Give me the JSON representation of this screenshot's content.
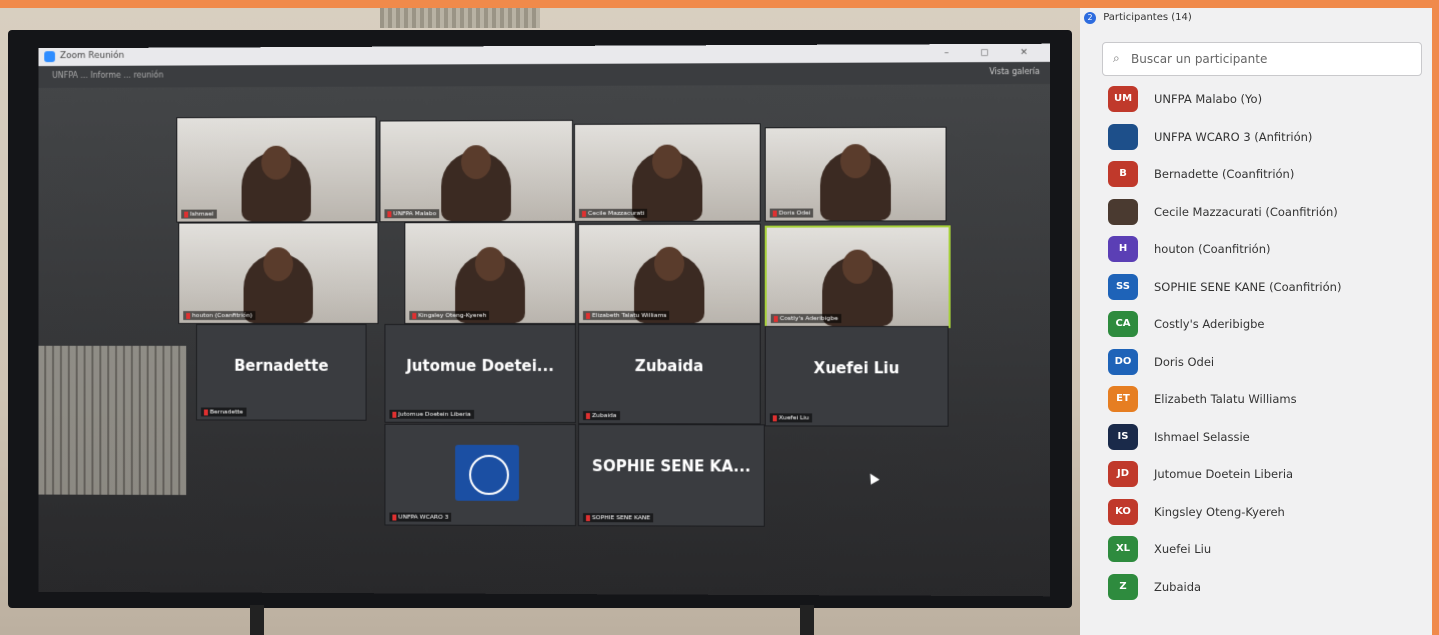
{
  "app": {
    "title": "Zoom Reunión",
    "subtitle": "UNFPA ... Informe ... reunión",
    "view_label": "Vista galería"
  },
  "tiles": [
    {
      "name": "tile-1",
      "type": "video",
      "label": "Ishmael"
    },
    {
      "name": "tile-2",
      "type": "video",
      "label": "UNFPA Malabo"
    },
    {
      "name": "tile-3",
      "type": "video",
      "label": "Cecile Mazzacurati"
    },
    {
      "name": "tile-4",
      "type": "video",
      "label": "Doris Odei"
    },
    {
      "name": "tile-5",
      "type": "video",
      "label": "houton (Coanfitrión)"
    },
    {
      "name": "tile-6",
      "type": "video",
      "label": "Kingsley Oteng-Kyereh"
    },
    {
      "name": "tile-7",
      "type": "video",
      "label": "Elizabeth Talatu Williams"
    },
    {
      "name": "tile-8",
      "type": "video",
      "label": "Costly's Aderibigbe"
    },
    {
      "name": "tile-9",
      "type": "name",
      "big": "Bernadette",
      "label": "Bernadette"
    },
    {
      "name": "tile-10",
      "type": "name",
      "big": "Jutomue Doetei...",
      "label": "Jutomue Doetein Liberia"
    },
    {
      "name": "tile-11",
      "type": "name",
      "big": "Zubaida",
      "label": "Zubaida"
    },
    {
      "name": "tile-12",
      "type": "name",
      "big": "Xuefei Liu",
      "label": "Xuefei Liu"
    },
    {
      "name": "tile-13",
      "type": "logo",
      "label": "UNFPA WCARO 3"
    },
    {
      "name": "tile-14",
      "type": "name",
      "big": "SOPHIE SENE KA...",
      "label": "SOPHIE SENE KANE"
    }
  ],
  "participants_panel": {
    "count_badge": "2",
    "title": "Participantes (14)",
    "search_placeholder": "Buscar un participante",
    "participants": [
      {
        "initials": "UM",
        "name": "UNFPA Malabo (Yo)",
        "color": "#c0392b"
      },
      {
        "initials": "",
        "name": "UNFPA WCARO 3 (Anfitrión)",
        "color": "#1d4f8a"
      },
      {
        "initials": "B",
        "name": "Bernadette (Coanfitrión)",
        "color": "#c0392b"
      },
      {
        "initials": "",
        "name": "Cecile Mazzacurati (Coanfitrión)",
        "color": "#4a3a30"
      },
      {
        "initials": "H",
        "name": "houton (Coanfitrión)",
        "color": "#5b3fb5"
      },
      {
        "initials": "SS",
        "name": "SOPHIE SENE KANE (Coanfitrión)",
        "color": "#1e63b8"
      },
      {
        "initials": "CA",
        "name": "Costly's Aderibigbe",
        "color": "#2e8b3e"
      },
      {
        "initials": "DO",
        "name": "Doris Odei",
        "color": "#1e63b8"
      },
      {
        "initials": "ET",
        "name": "Elizabeth Talatu Williams",
        "color": "#e67e22"
      },
      {
        "initials": "IS",
        "name": "Ishmael Selassie",
        "color": "#1a2a4a"
      },
      {
        "initials": "JD",
        "name": "Jutomue Doetein Liberia",
        "color": "#c0392b"
      },
      {
        "initials": "KO",
        "name": "Kingsley Oteng-Kyereh",
        "color": "#c0392b"
      },
      {
        "initials": "XL",
        "name": "Xuefei Liu",
        "color": "#2e8b3e"
      },
      {
        "initials": "Z",
        "name": "Zubaida",
        "color": "#2e8b3e"
      }
    ]
  }
}
